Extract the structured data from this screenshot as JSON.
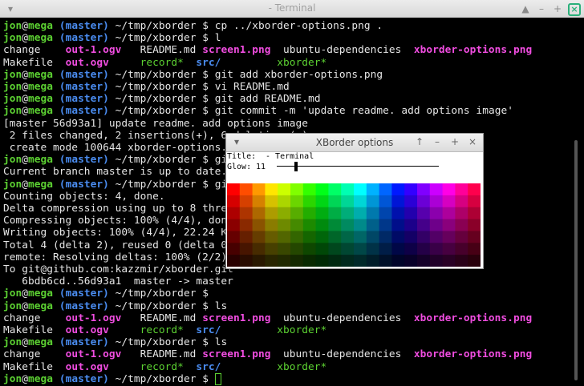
{
  "window": {
    "title": "- Terminal"
  },
  "prompt": {
    "user": "jon",
    "at": "@",
    "host": "mega",
    "branch": "(master)",
    "dir": "~/tmp/xborder",
    "dollar": "$"
  },
  "lines": [
    {
      "type": "prompt",
      "cmd": "cp ../xborder-options.png ."
    },
    {
      "type": "prompt",
      "cmd": "l"
    },
    {
      "type": "ls1"
    },
    {
      "type": "ls2"
    },
    {
      "type": "prompt",
      "cmd": "git add xborder-options.png"
    },
    {
      "type": "prompt",
      "cmd": "vi README.md"
    },
    {
      "type": "prompt",
      "cmd": "git add README.md"
    },
    {
      "type": "prompt",
      "cmd": "git commit -m 'update readme. add options image'"
    },
    {
      "type": "text",
      "text": "[master 56d93a1] update readme. add options image"
    },
    {
      "type": "text",
      "text": " 2 files changed, 2 insertions(+), 6 deletions(-)"
    },
    {
      "type": "text",
      "text": " create mode 100644 xborder-options.png"
    },
    {
      "type": "prompt",
      "cmd": "git status"
    },
    {
      "type": "text",
      "text": "Current branch master is up to date."
    },
    {
      "type": "prompt",
      "cmd": "git push"
    },
    {
      "type": "text",
      "text": "Counting objects: 4, done."
    },
    {
      "type": "text",
      "text": "Delta compression using up to 8 threads."
    },
    {
      "type": "text",
      "text": "Compressing objects: 100% (4/4), done."
    },
    {
      "type": "text",
      "text": "Writing objects: 100% (4/4), 22.24 KiB, done."
    },
    {
      "type": "text",
      "text": "Total 4 (delta 2), reused 0 (delta 0)"
    },
    {
      "type": "text",
      "text": "remote: Resolving deltas: 100% (2/2), completed with 2 local objects."
    },
    {
      "type": "text",
      "text": "To git@github.com:kazzmir/xborder.git"
    },
    {
      "type": "text",
      "text": "   6bdb6cd..56d93a1  master -> master"
    },
    {
      "type": "prompt",
      "cmd": ""
    },
    {
      "type": "prompt",
      "cmd": "ls"
    },
    {
      "type": "ls1"
    },
    {
      "type": "ls2"
    },
    {
      "type": "prompt",
      "cmd": "ls"
    },
    {
      "type": "ls1"
    },
    {
      "type": "ls2"
    },
    {
      "type": "prompt",
      "cmd": "",
      "cursor": true
    }
  ],
  "ls": {
    "row1": [
      {
        "name": "change",
        "cls": "w"
      },
      {
        "name": "out-1.ogv",
        "cls": "m"
      },
      {
        "name": "README.md",
        "cls": "w"
      },
      {
        "name": "screen1.png",
        "cls": "m"
      },
      {
        "name": "ubuntu-dependencies",
        "cls": "w"
      },
      {
        "name": "xborder-options.png",
        "cls": "m"
      }
    ],
    "row2": [
      {
        "name": "Makefile",
        "cls": "w"
      },
      {
        "name": "out.ogv",
        "cls": "m"
      },
      {
        "name": "record*",
        "cls": "gr"
      },
      {
        "name": "src/",
        "cls": "b"
      },
      {
        "name": "xborder*",
        "cls": "gr"
      }
    ]
  },
  "dialog": {
    "title": "XBorder options",
    "title_label": "Title:",
    "title_value": " - Terminal",
    "glow_label": "Glow:",
    "glow_value": "11",
    "glow_level": 0.12
  },
  "icons": {
    "terminal_titlebar": [
      "window-menu-icon",
      "minimize-icon",
      "maximize-icon",
      "close-icon"
    ],
    "dialog_titlebar": [
      "dialog-menu-icon",
      "dialog-up-icon",
      "dialog-minimize-icon",
      "dialog-maximize-icon",
      "dialog-close-icon"
    ]
  },
  "colors": {
    "prompt_green": "#5cd132",
    "prompt_blue": "#4a8cf0",
    "magenta": "#f04de0",
    "text": "#e6e6e6",
    "background": "#000000"
  }
}
